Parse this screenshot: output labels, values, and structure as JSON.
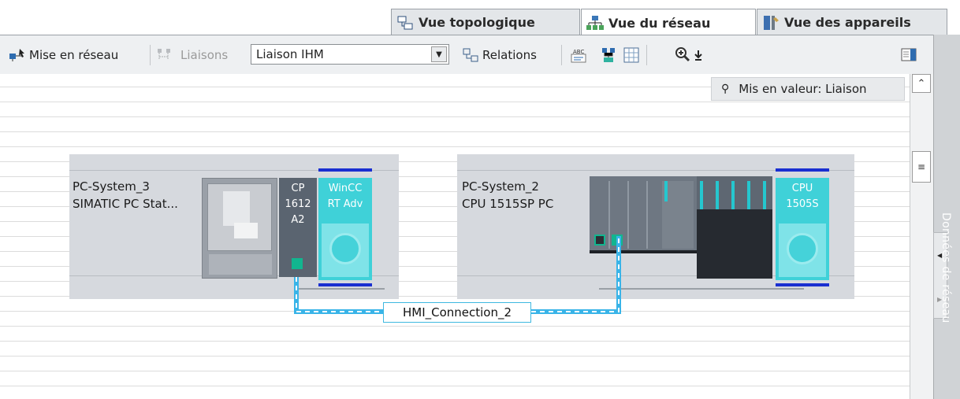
{
  "tabs": [
    {
      "label": "Vue topologique",
      "icon": "topology-view-icon",
      "active": false
    },
    {
      "label": "Vue du réseau",
      "icon": "network-view-icon",
      "active": true
    },
    {
      "label": "Vue des appareils",
      "icon": "device-view-icon",
      "active": false
    }
  ],
  "toolbar": {
    "network_label": "Mise en réseau",
    "connections_label": "Liaisons",
    "connection_type_value": "Liaison IHM",
    "relations_label": "Relations"
  },
  "canvas": {
    "highlight_text": "Mis en valeur: Liaison"
  },
  "devices": [
    {
      "name": "PC-System_3",
      "type": "SIMATIC PC Stat...",
      "cp_module": [
        "CP",
        "1612",
        "A2"
      ],
      "app_module": [
        "WinCC",
        "RT Adv"
      ]
    },
    {
      "name": "PC-System_2",
      "type": "CPU 1515SP PC",
      "cpu_module": [
        "CPU",
        "1505S"
      ]
    }
  ],
  "connection": {
    "label": "HMI_Connection_2"
  },
  "side_panel": {
    "label": "Données de réseau"
  },
  "colors": {
    "accent_cyan": "#3fd1d8",
    "connection_blue": "#39b4e8",
    "port_green": "#12b58f",
    "highlight_blue": "#1a2fd1"
  }
}
